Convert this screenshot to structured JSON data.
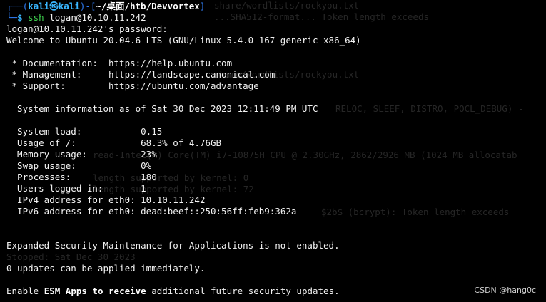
{
  "prompt": {
    "prefix": "┌──(",
    "user": "kali",
    "at": "㉿",
    "host": "kali",
    "mid": ")-[",
    "path": "~/桌面/htb/Devvortex",
    "suffix": "]",
    "line2_prefix": "└─",
    "dollar": "$",
    "command": "ssh",
    "argument": " logan@10.10.11.242"
  },
  "output": {
    "password_prompt": "logan@10.10.11.242's password:",
    "welcome": "Welcome to Ubuntu 20.04.6 LTS (GNU/Linux 5.4.0-167-generic x86_64)",
    "links": [
      {
        "label": " * Documentation:  ",
        "url": "https://help.ubuntu.com"
      },
      {
        "label": " * Management:     ",
        "url": "https://landscape.canonical.com"
      },
      {
        "label": " * Support:        ",
        "url": "https://ubuntu.com/advantage"
      }
    ],
    "sysinfo_header": "  System information as of Sat 30 Dec 2023 12:11:49 PM UTC",
    "sysinfo": [
      {
        "label": "  System load:           ",
        "value": "0.15"
      },
      {
        "label": "  Usage of /:            ",
        "value": "68.3% of 4.76GB"
      },
      {
        "label": "  Memory usage:          ",
        "value": "23%"
      },
      {
        "label": "  Swap usage:            ",
        "value": "0%"
      },
      {
        "label": "  Processes:             ",
        "value": "180"
      },
      {
        "label": "  Users logged in:       ",
        "value": "1"
      },
      {
        "label": "  IPv4 address for eth0: ",
        "value": "10.10.11.242"
      },
      {
        "label": "  IPv6 address for eth0: ",
        "value": "dead:beef::250:56ff:feb9:362a"
      }
    ],
    "esm_notice": "Expanded Security Maintenance for Applications is not enabled.",
    "updates": "0 updates can be applied immediately.",
    "esm_line": {
      "pre": "Enable ",
      "b1": "ESM Apps",
      "mid": " to ",
      "b2": "receive",
      "post": " additional future security updates."
    }
  },
  "watermark": "CSDN @hang0c",
  "colors": {
    "background": "#000000",
    "prompt_frame": "#2f7df5",
    "prompt_user": "#39b6ff",
    "command": "#3fd34f",
    "text": "#f2f2f2"
  }
}
